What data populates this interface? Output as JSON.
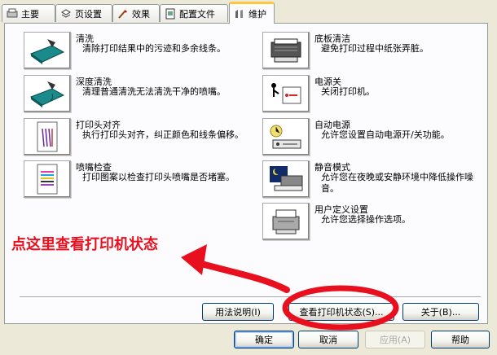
{
  "tabs": [
    {
      "label": "主要",
      "icon": "main-icon"
    },
    {
      "label": "页设置",
      "icon": "page-setup-icon"
    },
    {
      "label": "效果",
      "icon": "effects-icon"
    },
    {
      "label": "配置文件",
      "icon": "profile-icon"
    },
    {
      "label": "维护",
      "icon": "maintenance-icon",
      "active": true
    }
  ],
  "maintenance": {
    "left": [
      {
        "title": "清洗",
        "desc": "清除打印结果中的污迹和多余线条。",
        "icon": "cleaning-icon"
      },
      {
        "title": "深度清洗",
        "desc": "清理普通清洗无法清洗干净的喷嘴。",
        "icon": "deep-cleaning-icon"
      },
      {
        "title": "打印头对齐",
        "desc": "执行打印头对齐，纠正颜色和线条偏移。",
        "icon": "print-head-alignment-icon"
      },
      {
        "title": "喷嘴检查",
        "desc": "打印图案以检查打印头喷嘴是否堵塞。",
        "icon": "nozzle-check-icon"
      }
    ],
    "right": [
      {
        "title": "底板清洁",
        "desc": "避免打印过程中纸张弄脏。",
        "icon": "bottom-plate-cleaning-icon"
      },
      {
        "title": "电源关",
        "desc": "关闭打印机。",
        "icon": "power-off-icon"
      },
      {
        "title": "自动电源",
        "desc": "允许您设置自动电源开/关功能。",
        "icon": "auto-power-icon"
      },
      {
        "title": "静音模式",
        "desc": "允许您在夜晚或安静环境中降低操作噪音。",
        "icon": "quiet-mode-icon"
      },
      {
        "title": "用户定义设置",
        "desc": "允许您选择操作选项。",
        "icon": "custom-settings-icon"
      }
    ]
  },
  "panel_buttons": {
    "instructions": "用法说明(I)",
    "view_status": "查看打印机状态(S)...",
    "about": "关于(B)..."
  },
  "dialog_buttons": {
    "ok": "确定",
    "cancel": "取消",
    "apply": "应用(A)",
    "help": "帮助"
  },
  "annotation": {
    "text": "点这里查看打印机状态",
    "color": "#e8101e"
  }
}
